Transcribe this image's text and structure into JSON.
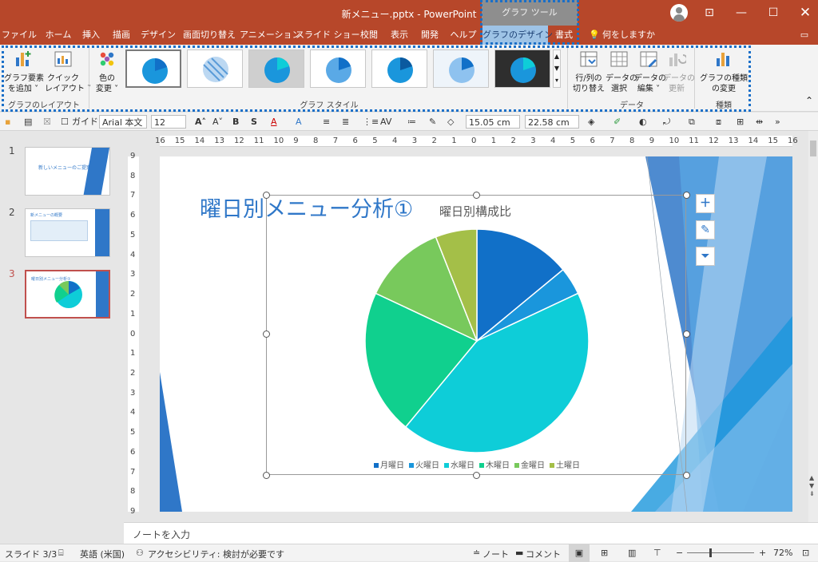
{
  "window": {
    "doc_title": "新メニュー.pptx  -  PowerPoint",
    "context_tools": "グラフ ツール"
  },
  "tabs": [
    "ファイル",
    "ホーム",
    "挿入",
    "描画",
    "デザイン",
    "画面切り替え",
    "アニメーション",
    "スライド ショー",
    "校閲",
    "表示",
    "開発",
    "ヘルプ",
    "グラフのデザイン",
    "書式"
  ],
  "tell_me": "何をしますか",
  "ribbon": {
    "add_element": "グラフ要素\nを追加 ˅",
    "quick_layout": "クイック\nレイアウト ˅",
    "group_layout": "グラフのレイアウト",
    "change_colors": "色の\n変更 ˅",
    "group_styles": "グラフ スタイル",
    "switch_row_col": "行/列の\n切り替え",
    "select_data": "データの\n選択",
    "edit_data": "データの\n編集 ˅",
    "refresh_data": "データの\n更新",
    "group_data": "データ",
    "change_type": "グラフの種類\nの変更",
    "group_type": "種類"
  },
  "toolbar": {
    "guide": "ガイド",
    "font_name": "Arial 本文",
    "font_size": "12",
    "height": "15.05 cm",
    "width": "22.58 cm"
  },
  "ruler_h": [
    "16",
    "15",
    "14",
    "13",
    "12",
    "11",
    "10",
    "9",
    "8",
    "7",
    "6",
    "5",
    "4",
    "3",
    "2",
    "1",
    "0",
    "1",
    "2",
    "3",
    "4",
    "5",
    "6",
    "7",
    "8",
    "9",
    "10",
    "11",
    "12",
    "13",
    "14",
    "15",
    "16"
  ],
  "ruler_v": [
    "9",
    "8",
    "7",
    "6",
    "5",
    "4",
    "3",
    "2",
    "1",
    "0",
    "1",
    "2",
    "3",
    "4",
    "5",
    "6",
    "7",
    "8",
    "9"
  ],
  "slides": [
    {
      "num": "1",
      "title": "新しいメニューのご提案"
    },
    {
      "num": "2",
      "title": "新メニューの概要"
    },
    {
      "num": "3",
      "title": "曜日別メニュー分析①"
    }
  ],
  "slide": {
    "title": "曜日別メニュー分析①"
  },
  "chart_data": {
    "type": "pie",
    "title": "曜日別構成比",
    "categories": [
      "月曜日",
      "火曜日",
      "水曜日",
      "木曜日",
      "金曜日",
      "土曜日"
    ],
    "values": [
      14,
      4,
      43,
      21,
      12,
      6
    ],
    "colors": [
      "#1170c8",
      "#1a96dc",
      "#0ecdd8",
      "#10d08e",
      "#78c95c",
      "#a4bf48"
    ],
    "legend_position": "bottom"
  },
  "notes_placeholder": "ノートを入力",
  "status": {
    "slide_info": "スライド 3/3",
    "language": "英語 (米国)",
    "accessibility": "アクセシビリティ: 検討が必要です",
    "notes_btn": "ノート",
    "comments_btn": "コメント",
    "zoom": "72%"
  }
}
